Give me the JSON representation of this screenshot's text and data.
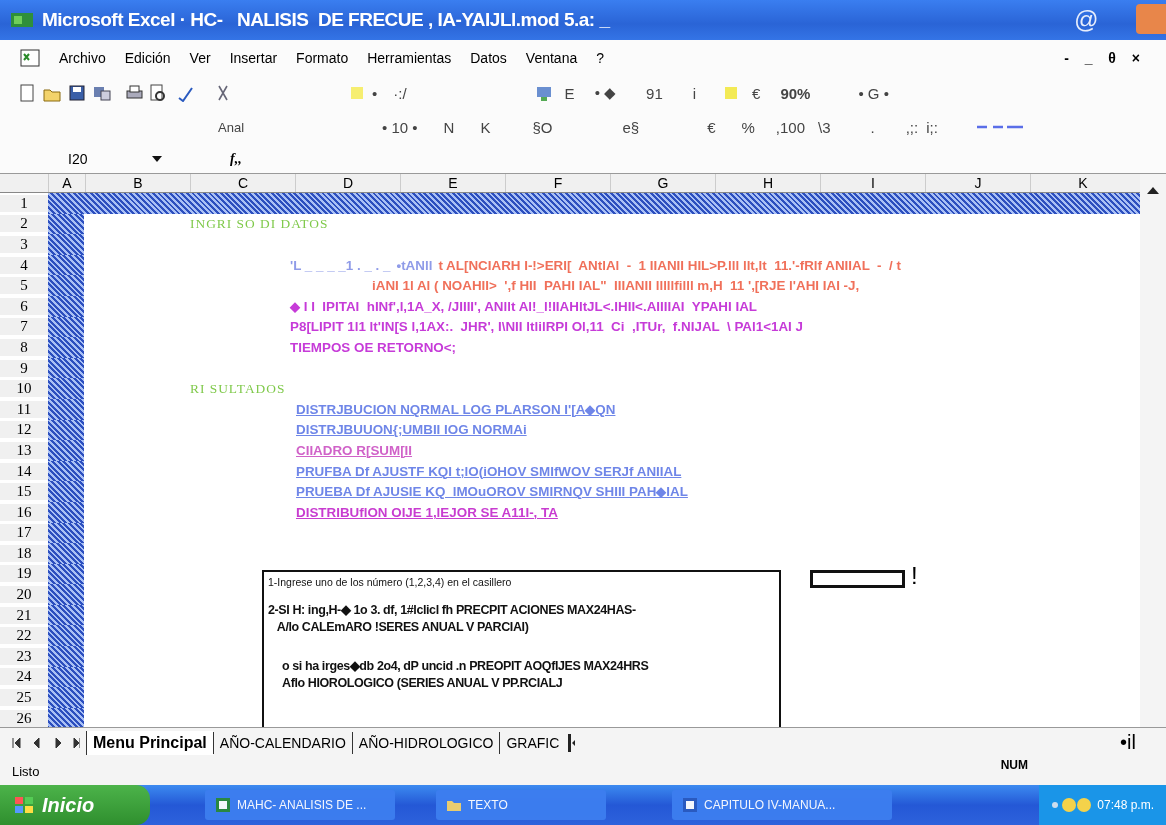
{
  "window": {
    "title": "Microsoft Excel · HC-   NALISIS  DE FRECUE , IA-YAIJLl.mod 5.a: _",
    "corner": "@"
  },
  "menu": {
    "items": [
      "Archivo",
      "Edición",
      "Ver",
      "Insertar",
      "Formato",
      "Herramientas",
      "Datos",
      "Ventana",
      "?"
    ],
    "controls": "- _ θ ×"
  },
  "toolbar_standard": [
    "•",
    "·:/",
    "E",
    "• ◆",
    "91",
    "i",
    "€",
    "90%",
    "•  G  •"
  ],
  "toolbar_format": [
    "Anal",
    "•  10  •",
    "N",
    "K",
    "§O",
    "e§",
    "€",
    "%",
    ",100",
    "\\3",
    ".",
    ",;:",
    "i;:"
  ],
  "formula_bar": {
    "name_box": "I20",
    "fx": "f,,"
  },
  "sheet": {
    "columns": [
      "A",
      "B",
      "C",
      "D",
      "E",
      "F",
      "G",
      "H",
      "I",
      "J",
      "K"
    ],
    "rows": [
      {
        "header": "1"
      },
      {
        "header": "2",
        "texts": [
          {
            "kind": "heading",
            "text": "INGRI SO DI DATOS",
            "color": "#7fc94a"
          }
        ]
      },
      {
        "header": "3"
      },
      {
        "header": "4",
        "texts": [
          {
            "kind": "item",
            "text": "'L _ _ _ _1 . _ . _",
            "color": "#8f9be8"
          },
          {
            "kind": "item",
            "text": "•tANll",
            "color": "#8f9be8"
          },
          {
            "kind": "item",
            "text": "t AL[NCIARH I-!>ERI[  ANtlAl  -  1 IIANII HIL>P.lll llt,lt  11.'-fRlf ANIIAL  -  / t",
            "color": "#f0705a"
          }
        ]
      },
      {
        "header": "5",
        "texts": [
          {
            "kind": "sub",
            "text": "iANI 1l Al ( NOAHII>  ',f HII  PAHI IAL\"  IIIANII lllllfilll m,H  11 ',[RJE l'AHI IAI -J,",
            "color": "#f0705a"
          }
        ]
      },
      {
        "header": "6",
        "texts": [
          {
            "kind": "item",
            "text": "◆ I I  IPITAI  hINf',l,1A_X, /JIIII', ANllt Al!_l!IIAHltJL<.IHII<.AIIIIAI  YPAHI IAL",
            "color": "#c63bd8"
          }
        ]
      },
      {
        "header": "7",
        "texts": [
          {
            "kind": "item",
            "text": "P8[LIPIT 1l1 lt'IN[S l,1AX:.  JHR', I\\NII ltlilRPI Ol,11  Ci  ,ITUr,  f.NIJAL  \\ PAl1<1AI J",
            "color": "#c63bd8"
          }
        ]
      },
      {
        "header": "8",
        "texts": [
          {
            "kind": "item",
            "text": "TIEMPOS OE RETORNO<;",
            "color": "#c63bd8"
          }
        ]
      },
      {
        "header": "9"
      },
      {
        "header": "10",
        "texts": [
          {
            "kind": "heading",
            "text": "RI SULTADOS",
            "color": "#7fc94a"
          }
        ]
      },
      {
        "header": "11",
        "texts": [
          {
            "kind": "link",
            "text": "DISTRJBUCION NQRMAL LOG PLARSON I'[A◆QN",
            "color": "#6f86e8"
          }
        ]
      },
      {
        "header": "12",
        "texts": [
          {
            "kind": "link",
            "text": "DISTRJBUUON{;UMBII IOG NORMAi",
            "color": "#6f86e8"
          }
        ]
      },
      {
        "header": "13",
        "texts": [
          {
            "kind": "link",
            "text": "CIIADRO R[SUM[II",
            "color": "#d062c8"
          }
        ]
      },
      {
        "header": "14",
        "texts": [
          {
            "kind": "link",
            "text": "PRUFBA Df AJUSTF KQI t;lO(iOHOV SMIfWOV SERJf ANIIAL",
            "color": "#6f86e8"
          }
        ]
      },
      {
        "header": "15",
        "texts": [
          {
            "kind": "link",
            "text": "PRUEBA Df AJUSIE KQ_lMOuOROV SMIRNQV SHIII PAH◆IAL",
            "color": "#6f86e8"
          }
        ]
      },
      {
        "header": "16",
        "texts": [
          {
            "kind": "link",
            "text": "DISTRIBUflON OIJE 1,lEJOR SE A11I-, TA",
            "color": "#c83cd0"
          }
        ]
      },
      {
        "header": "17"
      },
      {
        "header": "18"
      },
      {
        "header": "19"
      },
      {
        "header": "20"
      },
      {
        "header": "21"
      },
      {
        "header": "22"
      },
      {
        "header": "23"
      },
      {
        "header": "24"
      },
      {
        "header": "25"
      },
      {
        "header": "26"
      }
    ],
    "note_box": {
      "line_1": "1-Ingrese uno de los número (1,2,3,4) en el casillero",
      "paragraph_2": "2-SI H: ing,H-◆ 1o 3. df, 1#lclicl fh PRECPIT ACIONES MAX24HAS-\n   A/lo CALEmARO !SERES ANUAL V PARCIAI)",
      "paragraph_3": "o si ha irges◆db 2o4, dP uncid .n PREOPIT AOQflJES MAX24HRS\nAflo HIOROLOGICO (SERIES ANUAL V PP.RCIALJ"
    },
    "input_mark": "!"
  },
  "sheet_tabs": [
    {
      "label": "Menu Principal",
      "selected": true
    },
    {
      "label": "AÑO-CALENDARIO",
      "selected": false
    },
    {
      "label": "AÑO-HIDROLOGICO",
      "selected": false
    },
    {
      "label": "GRAFIC",
      "selected": false
    }
  ],
  "tab_bar_right": "•il",
  "status_bar": {
    "left": "Listo",
    "right": "NUM"
  },
  "taskbar": {
    "start": "Inicio",
    "buttons": [
      "MAHC- ANALISIS DE ...",
      "TEXTO",
      "CAPITULO IV-MANUA..."
    ],
    "clock": "07:48 p.m."
  }
}
